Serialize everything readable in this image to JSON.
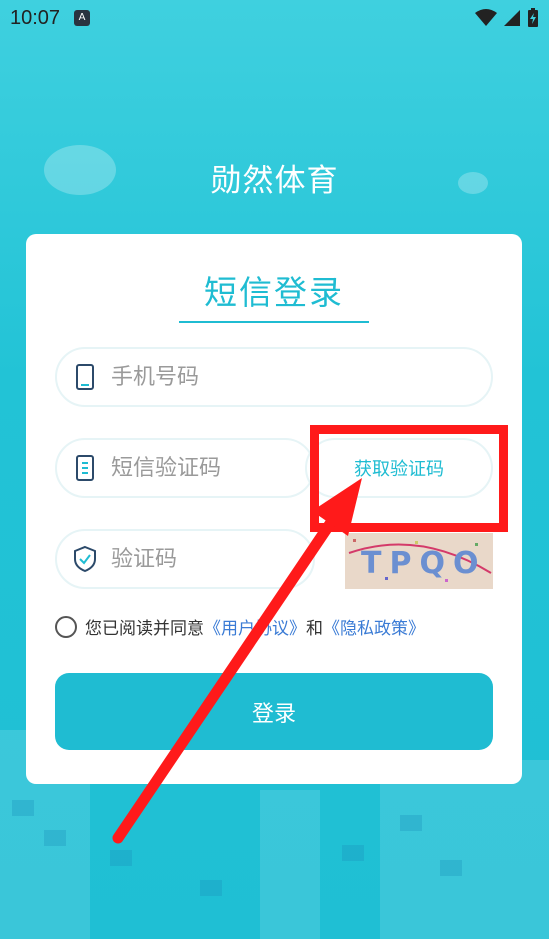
{
  "status_bar": {
    "time": "10:07",
    "notification_badge": "A"
  },
  "app": {
    "title": "勋然体育"
  },
  "login": {
    "title": "短信登录",
    "phone": {
      "placeholder": "手机号码",
      "value": ""
    },
    "sms_code": {
      "placeholder": "短信验证码",
      "value": ""
    },
    "get_code_button": "获取验证码",
    "captcha": {
      "placeholder": "验证码",
      "value": "",
      "image_text": "TPQO"
    },
    "agreement": {
      "prefix": "您已阅读并同意",
      "user_agreement": "《用户协议》",
      "conjunction": "和",
      "privacy_policy": "《隐私政策》"
    },
    "submit_button": "登录"
  },
  "colors": {
    "accent": "#1fbcd2",
    "link": "#3a7bd5",
    "annotation": "#ff1a1a"
  }
}
